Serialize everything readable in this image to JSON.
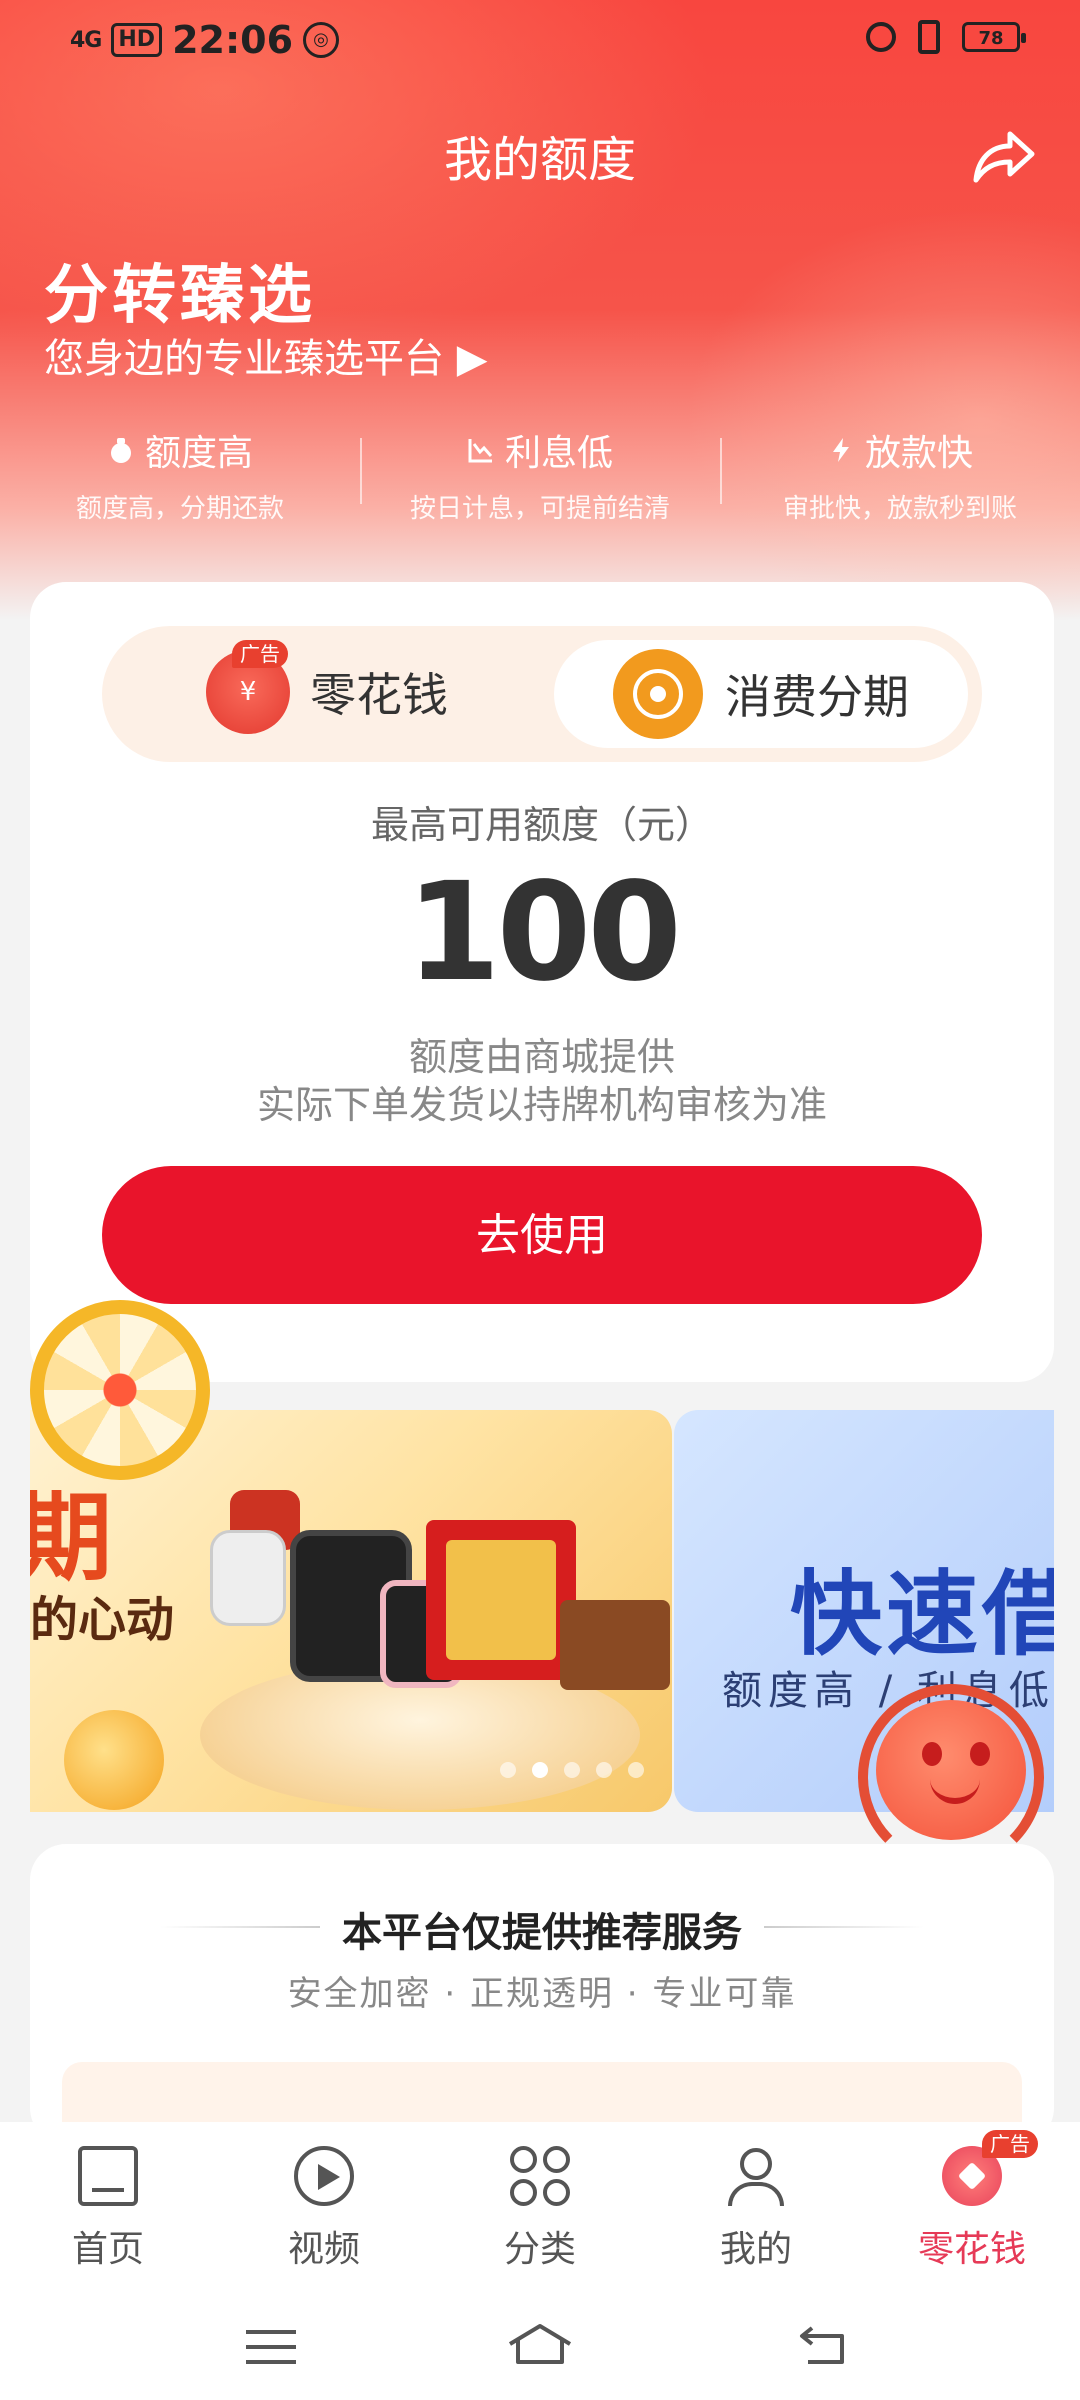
{
  "status_bar": {
    "signal": "4G",
    "hd": "HD",
    "time": "22:06",
    "battery": "78"
  },
  "header": {
    "title": "我的额度"
  },
  "brand": {
    "title": "分转臻选",
    "subtitle": "您身边的专业臻选平台 ▶"
  },
  "features": [
    {
      "title": "额度高",
      "desc": "额度高，分期还款",
      "icon": "moneybag-icon"
    },
    {
      "title": "利息低",
      "desc": "按日计息，可提前结清",
      "icon": "chart-down-icon"
    },
    {
      "title": "放款快",
      "desc": "审批快，放款秒到账",
      "icon": "lightning-icon"
    }
  ],
  "toggle": {
    "left_label": "零花钱",
    "left_ad": "广告",
    "left_logo": "¥",
    "right_label": "消费分期"
  },
  "limit": {
    "label": "最高可用额度（元）",
    "value": "100",
    "note1": "额度由商城提供",
    "note2": "实际下单发货以持牌机构审核为准",
    "button": "去使用"
  },
  "banners": {
    "b1_big": "期",
    "b1_text": "的心动",
    "b2_title": "快速借",
    "b2_sub": "额度高 / 利息低"
  },
  "recommend": {
    "title": "本平台仅提供推荐服务",
    "subtitle": "安全加密 · 正规透明 · 专业可靠"
  },
  "bottom_nav": [
    {
      "label": "首页",
      "active": false
    },
    {
      "label": "视频",
      "active": false
    },
    {
      "label": "分类",
      "active": false
    },
    {
      "label": "我的",
      "active": false
    },
    {
      "label": "零花钱",
      "active": true,
      "ad": "广告"
    }
  ],
  "colors": {
    "primary_red": "#e9142b",
    "header_red": "#f8463f",
    "active_nav": "#e63a57",
    "toggle_bg": "#fdf0e6",
    "installment_orange": "#f29a1e"
  }
}
